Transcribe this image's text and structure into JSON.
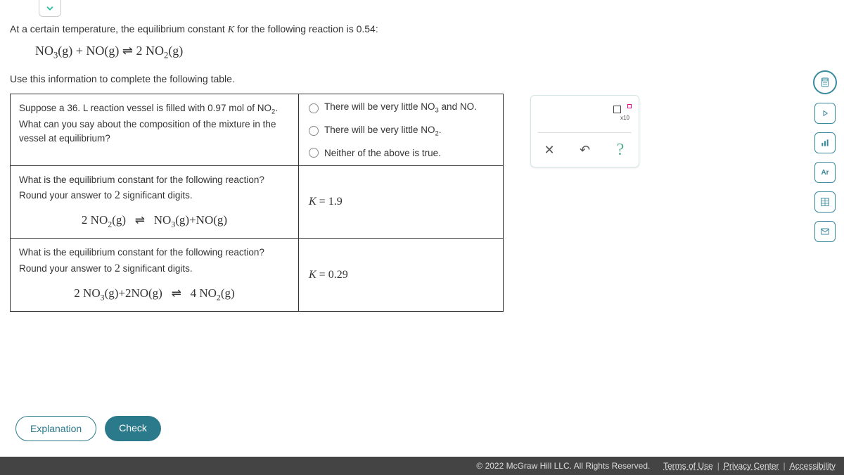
{
  "intro": {
    "line1_pre": "At a certain temperature, the equilibrium constant ",
    "line1_k": "K",
    "line1_post": " for the following reaction is ",
    "k_value": "0.54",
    "line1_end": ":",
    "equation_html": "NO₃(g) + NO(g) ⇌ 2 NO₂(g)",
    "line2": "Use this information to complete the following table."
  },
  "table": {
    "row1": {
      "q_part1": "Suppose a ",
      "vol": "36.",
      "q_part2": " L reaction vessel is filled with ",
      "mol": "0.97",
      "q_part3": " mol of NO₂. What can you say about the composition of the mixture in the vessel at equilibrium?",
      "opt1": "There will be very little NO₃ and NO.",
      "opt2": "There will be very little NO₂.",
      "opt3": "Neither of the above is true."
    },
    "row2": {
      "q_a": "What is the equilibrium constant for the following reaction?",
      "q_b": "Round your answer to 2 significant digits.",
      "eq": "2 NO₂(g)   ⇌   NO₃(g) + NO(g)",
      "k_label": "K",
      "k_rel": " = ",
      "k_val": "1.9"
    },
    "row3": {
      "q_a": "What is the equilibrium constant for the following reaction?",
      "q_b": "Round your answer to 2 significant digits.",
      "eq": "2 NO₃(g) + 2 NO(g)   ⇌   4 NO₂(g)",
      "k_label": "K",
      "k_rel": " = ",
      "k_val": "0.29"
    }
  },
  "toolbar": {
    "x10_label": "x10",
    "clear": "✕",
    "reset": "↶",
    "help": "?"
  },
  "buttons": {
    "explanation": "Explanation",
    "check": "Check"
  },
  "footer": {
    "copyright": "© 2022 McGraw Hill LLC. All Rights Reserved.",
    "terms": "Terms of Use",
    "privacy": "Privacy Center",
    "accessibility": "Accessibility"
  }
}
